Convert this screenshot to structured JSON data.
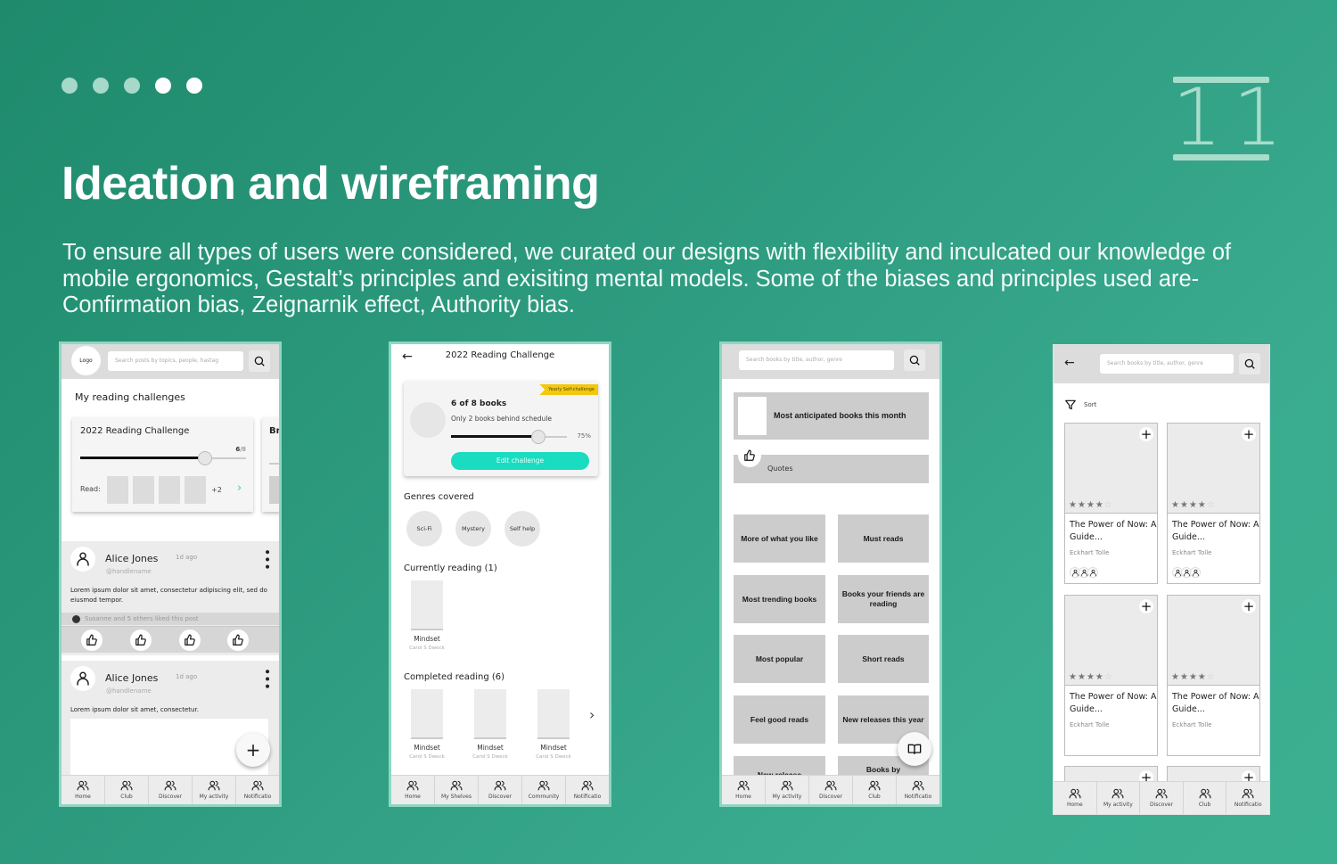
{
  "slide": {
    "pagination": {
      "total": 5,
      "active": [
        4,
        5
      ]
    },
    "page_number": "11",
    "title": "Ideation and wireframing",
    "intro": "To ensure all types of users were considered, we curated our designs with flexibility and inculcated our knowledge of mobile ergonomics, Gestalt’s principles and exisiting mental models. Some of the biases and principles used are- Confirmation bias, Zeignarnik effect, Authority bias.",
    "colors": {
      "accent": "#19dcc0",
      "tag": "#f2c811",
      "chevron": "#3cc9a8"
    }
  },
  "home_screen": {
    "logo": "Logo",
    "search_placeholder": "Search posts by topics, people, hastag",
    "section_title": "My reading challenges",
    "challenge": {
      "title": "2022 Reading Challenge",
      "done": "6",
      "total": "/8",
      "progress": 0.75,
      "read_label": "Read:",
      "more": "+2"
    },
    "challenge2_title": "Br",
    "posts": [
      {
        "name": "Alice Jones",
        "time": "1d ago",
        "handle": "@handlename",
        "body": "Lorem ipsum dolor sit amet, consectetur adipiscing elit, sed do eiusmod tempor.",
        "likes": "Susanne and 5 others liked this post"
      },
      {
        "name": "Alice Jones",
        "time": "1d ago",
        "handle": "@handlename",
        "body": "Lorem ipsum dolor sit amet, consectetur."
      }
    ],
    "fab": "+",
    "nav": [
      "Home",
      "Club",
      "Discover",
      "My activity",
      "Notificatio"
    ]
  },
  "challenge_screen": {
    "back": "←",
    "title": "2022 Reading Challenge",
    "tag": "Yearly Self-challenge",
    "books_count": "6 of 8 books",
    "schedule": "Only 2 books behind schedule",
    "progress_label": "75%",
    "progress": 0.75,
    "edit_button": "Edit challenge",
    "genres_title": "Genres covered",
    "genres": [
      "Sci-Fi",
      "Mystery",
      "Self help"
    ],
    "currently_title": "Currently reading (1)",
    "currently": [
      {
        "title": "Mindset",
        "author": "Carol S Dweck"
      }
    ],
    "completed_title": "Completed reading (6)",
    "completed": [
      {
        "title": "Mindset",
        "author": "Carol S Dweck"
      },
      {
        "title": "Mindset",
        "author": "Carol S Dweck"
      },
      {
        "title": "Mindset",
        "author": "Carol S Dweck"
      }
    ],
    "nav": [
      "Home",
      "My Shelves",
      "Discover",
      "Community",
      "Notificatio"
    ]
  },
  "discover_screen": {
    "search_placeholder": "Search books by title, author, genre",
    "banner": "Most anticipated books this month",
    "quotes": "Quotes",
    "tiles": [
      "More of what you like",
      "Must reads",
      "Most trending books",
      "Books your friends are reading",
      "Most popular",
      "Short reads",
      "Feel good reads",
      "New releases this year",
      "New release",
      "Books by"
    ],
    "nav": [
      "Home",
      "My activity",
      "Discover",
      "Club",
      "Notificatio"
    ]
  },
  "list_screen": {
    "back": "←",
    "search_placeholder": "Search books by title, author, genre",
    "sort": "Sort",
    "books": [
      {
        "title": "The Power of Now: A Guide...",
        "author": "Eckhart Tolle",
        "rating": 4,
        "max": 5,
        "readers": true
      },
      {
        "title": "The Power of Now: A Guide...",
        "author": "Eckhart Tolle",
        "rating": 4,
        "max": 5,
        "readers": true
      },
      {
        "title": "The Power of Now: A Guide...",
        "author": "Eckhart Tolle",
        "rating": 4,
        "max": 5,
        "readers": false
      },
      {
        "title": "The Power of Now: A Guide...",
        "author": "Eckhart Tolle",
        "rating": 4,
        "max": 5,
        "readers": false
      }
    ],
    "nav": [
      "Home",
      "My activity",
      "Discover",
      "Club",
      "Notificatio"
    ]
  }
}
